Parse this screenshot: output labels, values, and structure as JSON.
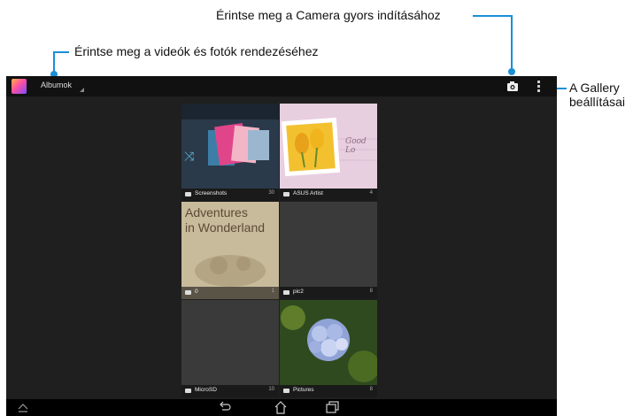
{
  "callouts": {
    "camera": "Érintse meg a Camera gyors indításához",
    "organize": "Érintse meg a videók és fotók rendezéséhez",
    "settings_line1": "A Gallery",
    "settings_line2": "beállításai"
  },
  "actionbar": {
    "title": "Albumok"
  },
  "albums": [
    {
      "name": "Screenshots",
      "count": "30"
    },
    {
      "name": "ASUS Artist",
      "count": "4"
    },
    {
      "name": "0",
      "count": "1",
      "thumb_line1": "Adventures",
      "thumb_line2": "in Wonderland"
    },
    {
      "name": "pic2",
      "count": "8"
    },
    {
      "name": "MicroSD",
      "count": "10"
    },
    {
      "name": "Pictures",
      "count": "8"
    }
  ],
  "asus_thumb_text": "Good Lo",
  "colors": {
    "accent": "#1a8fd6",
    "screen_bg": "#1f1f1f",
    "actionbar_bg": "#111111"
  },
  "icons": [
    "gallery-app-icon",
    "camera-icon",
    "overflow-menu-icon",
    "folder-icon",
    "up-chevron-icon",
    "back-icon",
    "home-icon",
    "recent-apps-icon"
  ]
}
